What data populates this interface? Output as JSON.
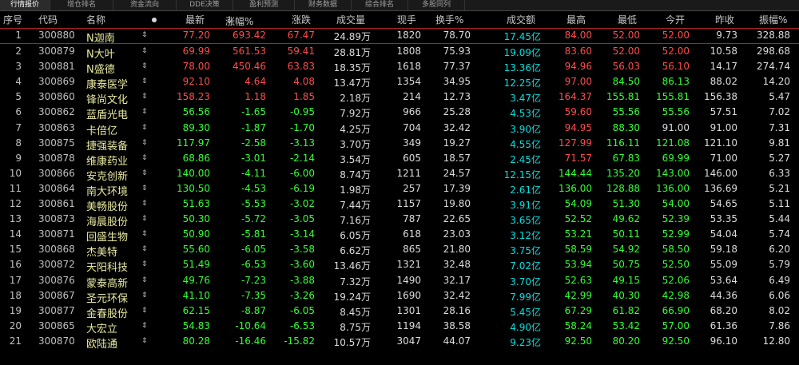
{
  "tabs": [
    "行情报价",
    "增仓排名",
    "资金流向",
    "DDE决策",
    "盈利预测",
    "财务数据",
    "综合排名",
    "多股同列"
  ],
  "headers": {
    "seq": "序号",
    "code": "代码",
    "name": "名称",
    "last": "最新",
    "chg_pct": "涨幅%",
    "sort_arrow": "↓",
    "chg": "涨跌",
    "volume": "成交量",
    "cur_vol": "现手",
    "turnover": "换手%",
    "amount": "成交额",
    "high": "最高",
    "low": "最低",
    "open": "今开",
    "prev_close": "昨收",
    "amplitude": "振幅%"
  },
  "rows": [
    {
      "seq": "1",
      "code": "300880",
      "name": "N迦南",
      "mark": "⇕",
      "last": "77.20",
      "chg_pct": "693.42",
      "chg": "67.47",
      "volume": "24.89万",
      "cur_vol": "1820",
      "turnover": "78.70",
      "amount": "17.45亿",
      "high": "84.00",
      "low": "52.00",
      "open": "52.00",
      "prev_close": "9.73",
      "amplitude": "328.88",
      "dir": "up",
      "high_dir": "up",
      "low_dir": "up",
      "open_dir": "up"
    },
    {
      "seq": "2",
      "code": "300879",
      "name": "N大叶",
      "mark": "⇕",
      "last": "69.99",
      "chg_pct": "561.53",
      "chg": "59.41",
      "volume": "28.81万",
      "cur_vol": "1808",
      "turnover": "75.93",
      "amount": "19.09亿",
      "high": "83.60",
      "low": "52.00",
      "open": "52.00",
      "prev_close": "10.58",
      "amplitude": "298.68",
      "dir": "up",
      "high_dir": "up",
      "low_dir": "up",
      "open_dir": "up"
    },
    {
      "seq": "3",
      "code": "300881",
      "name": "N盛德",
      "mark": "⇕",
      "last": "78.00",
      "chg_pct": "450.46",
      "chg": "63.83",
      "volume": "18.35万",
      "cur_vol": "1618",
      "turnover": "77.37",
      "amount": "13.36亿",
      "high": "94.96",
      "low": "56.03",
      "open": "56.10",
      "prev_close": "14.17",
      "amplitude": "274.74",
      "dir": "up",
      "high_dir": "up",
      "low_dir": "up",
      "open_dir": "up"
    },
    {
      "seq": "4",
      "code": "300869",
      "name": "康泰医学",
      "mark": "⇕",
      "last": "92.10",
      "chg_pct": "4.64",
      "chg": "4.08",
      "volume": "13.47万",
      "cur_vol": "1354",
      "turnover": "34.95",
      "amount": "12.25亿",
      "high": "97.00",
      "low": "84.50",
      "open": "86.13",
      "prev_close": "88.02",
      "amplitude": "14.20",
      "dir": "up",
      "high_dir": "up",
      "low_dir": "down",
      "open_dir": "down"
    },
    {
      "seq": "5",
      "code": "300860",
      "name": "锋尚文化",
      "mark": "⇕",
      "last": "158.23",
      "chg_pct": "1.18",
      "chg": "1.85",
      "volume": "2.18万",
      "cur_vol": "214",
      "turnover": "12.73",
      "amount": "3.47亿",
      "high": "164.37",
      "low": "155.81",
      "open": "155.81",
      "prev_close": "156.38",
      "amplitude": "5.47",
      "dir": "up",
      "high_dir": "up",
      "low_dir": "down",
      "open_dir": "down"
    },
    {
      "seq": "6",
      "code": "300862",
      "name": "蓝盾光电",
      "mark": "⇕",
      "last": "56.56",
      "chg_pct": "-1.65",
      "chg": "-0.95",
      "volume": "7.92万",
      "cur_vol": "966",
      "turnover": "25.28",
      "amount": "4.53亿",
      "high": "59.60",
      "low": "55.56",
      "open": "55.56",
      "prev_close": "57.51",
      "amplitude": "7.02",
      "dir": "down",
      "high_dir": "up",
      "low_dir": "down",
      "open_dir": "down"
    },
    {
      "seq": "7",
      "code": "300863",
      "name": "卡倍亿",
      "mark": "⇕",
      "last": "89.30",
      "chg_pct": "-1.87",
      "chg": "-1.70",
      "volume": "4.25万",
      "cur_vol": "704",
      "turnover": "32.42",
      "amount": "3.90亿",
      "high": "94.95",
      "low": "88.30",
      "open": "91.00",
      "prev_close": "91.00",
      "amplitude": "7.31",
      "dir": "down",
      "high_dir": "up",
      "low_dir": "down",
      "open_dir": "flat"
    },
    {
      "seq": "8",
      "code": "300875",
      "name": "捷强装备",
      "mark": "⇕",
      "last": "117.97",
      "chg_pct": "-2.58",
      "chg": "-3.13",
      "volume": "3.70万",
      "cur_vol": "349",
      "turnover": "19.27",
      "amount": "4.55亿",
      "high": "127.99",
      "low": "116.11",
      "open": "121.08",
      "prev_close": "121.10",
      "amplitude": "9.81",
      "dir": "down",
      "high_dir": "up",
      "low_dir": "down",
      "open_dir": "down"
    },
    {
      "seq": "9",
      "code": "300878",
      "name": "维康药业",
      "mark": "⇕",
      "last": "68.86",
      "chg_pct": "-3.01",
      "chg": "-2.14",
      "volume": "3.54万",
      "cur_vol": "605",
      "turnover": "18.57",
      "amount": "2.45亿",
      "high": "71.57",
      "low": "67.83",
      "open": "69.99",
      "prev_close": "71.00",
      "amplitude": "5.27",
      "dir": "down",
      "high_dir": "up",
      "low_dir": "down",
      "open_dir": "down"
    },
    {
      "seq": "10",
      "code": "300866",
      "name": "安克创新",
      "mark": "⇕",
      "last": "140.00",
      "chg_pct": "-4.11",
      "chg": "-6.00",
      "volume": "8.74万",
      "cur_vol": "1211",
      "turnover": "24.57",
      "amount": "12.15亿",
      "high": "144.44",
      "low": "135.20",
      "open": "143.00",
      "prev_close": "146.00",
      "amplitude": "6.33",
      "dir": "down",
      "high_dir": "down",
      "low_dir": "down",
      "open_dir": "down"
    },
    {
      "seq": "11",
      "code": "300864",
      "name": "南大环境",
      "mark": "⇕",
      "last": "130.50",
      "chg_pct": "-4.53",
      "chg": "-6.19",
      "volume": "1.98万",
      "cur_vol": "257",
      "turnover": "17.39",
      "amount": "2.61亿",
      "high": "136.00",
      "low": "128.88",
      "open": "136.00",
      "prev_close": "136.69",
      "amplitude": "5.21",
      "dir": "down",
      "high_dir": "down",
      "low_dir": "down",
      "open_dir": "down"
    },
    {
      "seq": "12",
      "code": "300861",
      "name": "美畅股份",
      "mark": "⇕",
      "last": "51.63",
      "chg_pct": "-5.53",
      "chg": "-3.02",
      "volume": "7.44万",
      "cur_vol": "1157",
      "turnover": "19.80",
      "amount": "3.91亿",
      "high": "54.09",
      "low": "51.30",
      "open": "54.00",
      "prev_close": "54.65",
      "amplitude": "5.11",
      "dir": "down",
      "high_dir": "down",
      "low_dir": "down",
      "open_dir": "down"
    },
    {
      "seq": "13",
      "code": "300873",
      "name": "海晨股份",
      "mark": "⇕",
      "last": "50.30",
      "chg_pct": "-5.72",
      "chg": "-3.05",
      "volume": "7.16万",
      "cur_vol": "787",
      "turnover": "22.65",
      "amount": "3.65亿",
      "high": "52.52",
      "low": "49.62",
      "open": "52.39",
      "prev_close": "53.35",
      "amplitude": "5.44",
      "dir": "down",
      "high_dir": "down",
      "low_dir": "down",
      "open_dir": "down"
    },
    {
      "seq": "14",
      "code": "300871",
      "name": "回盛生物",
      "mark": "⇕",
      "last": "50.90",
      "chg_pct": "-5.81",
      "chg": "-3.14",
      "volume": "6.05万",
      "cur_vol": "618",
      "turnover": "23.03",
      "amount": "3.12亿",
      "high": "53.21",
      "low": "50.11",
      "open": "52.99",
      "prev_close": "54.04",
      "amplitude": "5.74",
      "dir": "down",
      "high_dir": "down",
      "low_dir": "down",
      "open_dir": "down"
    },
    {
      "seq": "15",
      "code": "300868",
      "name": "杰美特",
      "mark": "⇕",
      "last": "55.60",
      "chg_pct": "-6.05",
      "chg": "-3.58",
      "volume": "6.62万",
      "cur_vol": "865",
      "turnover": "21.80",
      "amount": "3.75亿",
      "high": "58.59",
      "low": "54.92",
      "open": "58.50",
      "prev_close": "59.18",
      "amplitude": "6.20",
      "dir": "down",
      "high_dir": "down",
      "low_dir": "down",
      "open_dir": "down"
    },
    {
      "seq": "16",
      "code": "300872",
      "name": "天阳科技",
      "mark": "⇕",
      "last": "51.49",
      "chg_pct": "-6.53",
      "chg": "-3.60",
      "volume": "13.46万",
      "cur_vol": "1321",
      "turnover": "32.48",
      "amount": "7.02亿",
      "high": "53.94",
      "low": "50.75",
      "open": "52.50",
      "prev_close": "55.09",
      "amplitude": "5.79",
      "dir": "down",
      "high_dir": "down",
      "low_dir": "down",
      "open_dir": "down"
    },
    {
      "seq": "17",
      "code": "300876",
      "name": "蒙泰高新",
      "mark": "⇕",
      "last": "49.76",
      "chg_pct": "-7.23",
      "chg": "-3.88",
      "volume": "7.32万",
      "cur_vol": "1490",
      "turnover": "32.17",
      "amount": "3.70亿",
      "high": "52.63",
      "low": "49.15",
      "open": "52.06",
      "prev_close": "53.64",
      "amplitude": "6.49",
      "dir": "down",
      "high_dir": "down",
      "low_dir": "down",
      "open_dir": "down"
    },
    {
      "seq": "18",
      "code": "300867",
      "name": "圣元环保",
      "mark": "⇕",
      "last": "41.10",
      "chg_pct": "-7.35",
      "chg": "-3.26",
      "volume": "19.24万",
      "cur_vol": "1690",
      "turnover": "32.42",
      "amount": "7.99亿",
      "high": "42.99",
      "low": "40.30",
      "open": "42.98",
      "prev_close": "44.36",
      "amplitude": "6.06",
      "dir": "down",
      "high_dir": "down",
      "low_dir": "down",
      "open_dir": "down"
    },
    {
      "seq": "19",
      "code": "300877",
      "name": "金春股份",
      "mark": "⇕",
      "last": "62.15",
      "chg_pct": "-8.87",
      "chg": "-6.05",
      "volume": "8.45万",
      "cur_vol": "1301",
      "turnover": "28.16",
      "amount": "5.45亿",
      "high": "67.29",
      "low": "61.82",
      "open": "66.90",
      "prev_close": "68.20",
      "amplitude": "8.02",
      "dir": "down",
      "high_dir": "down",
      "low_dir": "down",
      "open_dir": "down"
    },
    {
      "seq": "20",
      "code": "300865",
      "name": "大宏立",
      "mark": "⇕",
      "last": "54.83",
      "chg_pct": "-10.64",
      "chg": "-6.53",
      "volume": "8.75万",
      "cur_vol": "1194",
      "turnover": "38.58",
      "amount": "4.90亿",
      "high": "58.24",
      "low": "53.42",
      "open": "57.00",
      "prev_close": "61.36",
      "amplitude": "7.86",
      "dir": "down",
      "high_dir": "down",
      "low_dir": "down",
      "open_dir": "down"
    },
    {
      "seq": "21",
      "code": "300870",
      "name": "欧陆通",
      "mark": "⇕",
      "last": "80.28",
      "chg_pct": "-16.46",
      "chg": "-15.82",
      "volume": "10.57万",
      "cur_vol": "3047",
      "turnover": "44.07",
      "amount": "9.23亿",
      "high": "92.50",
      "low": "80.20",
      "open": "92.50",
      "prev_close": "96.10",
      "amplitude": "12.80",
      "dir": "down",
      "high_dir": "down",
      "low_dir": "down",
      "open_dir": "down"
    }
  ]
}
